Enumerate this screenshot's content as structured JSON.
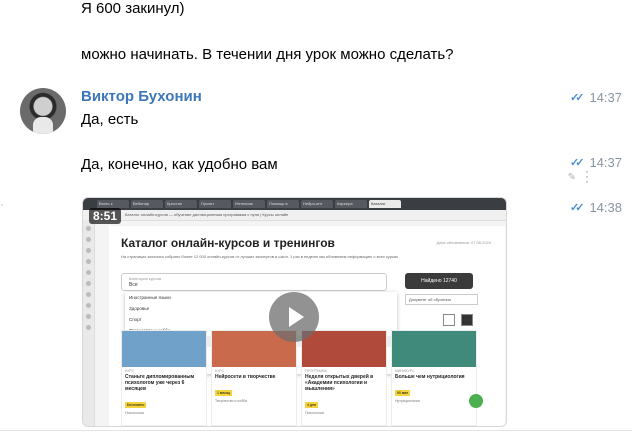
{
  "messages": [
    {
      "text": "Я 600 закинул)"
    },
    {
      "text": "можно начинать. В течении дня урок можно сделать?"
    }
  ],
  "reply": {
    "sender": "Виктор Бухонин",
    "items": [
      {
        "text": "Да, есть",
        "time": "14:37"
      },
      {
        "text": "Да, конечно, как удобно вам",
        "time": "14:37"
      },
      {
        "time": "14:38"
      }
    ]
  },
  "video": {
    "duration": "8:51",
    "tabs": [
      "Взять к",
      "Вебинар",
      "Кристал",
      "Проект",
      "Интенсив",
      "Помощь в",
      "Нейро-инт",
      "Карьера",
      "Каталог"
    ],
    "address": "Каталог онлайн-курсов — обучение дистанционным программам с нуля | Курсы онлайн",
    "page": {
      "title": "Каталог онлайн-курсов и тренингов",
      "subtitle": "На страницах каталога собрано более 12 000 онлайн-курсов от лучших экспертов и школ. 1 раз в неделю мы обновляем информацию о всех курсах",
      "note": "Дата обновления: 07.08.2024",
      "search_label": "Категория курсов",
      "search_value": "Все",
      "find_button": "Найдено 12740",
      "sort": "Документ об обучении",
      "dropdown": [
        "Иностранные языки",
        "Здоровье",
        "Спорт",
        "Творчество и хобби",
        "Искусство",
        "Духовные практики"
      ],
      "cards": [
        {
          "tag": "КУРС",
          "title": "Станьте дипломированным психологом уже через 6 месяцев",
          "badge": "Бесплатно",
          "cat": "Психология",
          "color": "#6fa1c9"
        },
        {
          "tag": "КУРС",
          "title": "Нейросети в творчестве",
          "badge": "1 месяц",
          "cat": "Творчество и хобби",
          "color": "#c96a4c"
        },
        {
          "tag": "ПРОГРАММА",
          "title": "Неделя открытых дверей в «Академии психологии и мышления»",
          "badge": "4 дня",
          "cat": "Психология",
          "color": "#b04a3a"
        },
        {
          "tag": "МИНИКУРС",
          "title": "Больше чем нутрициология",
          "badge": "90 мин",
          "cat": "Нутрициология",
          "color": "#3f8a7a"
        }
      ]
    }
  },
  "colors": {
    "sender": "#3e77b8",
    "checks": "#4a8ed6",
    "time": "#8a95a1"
  }
}
